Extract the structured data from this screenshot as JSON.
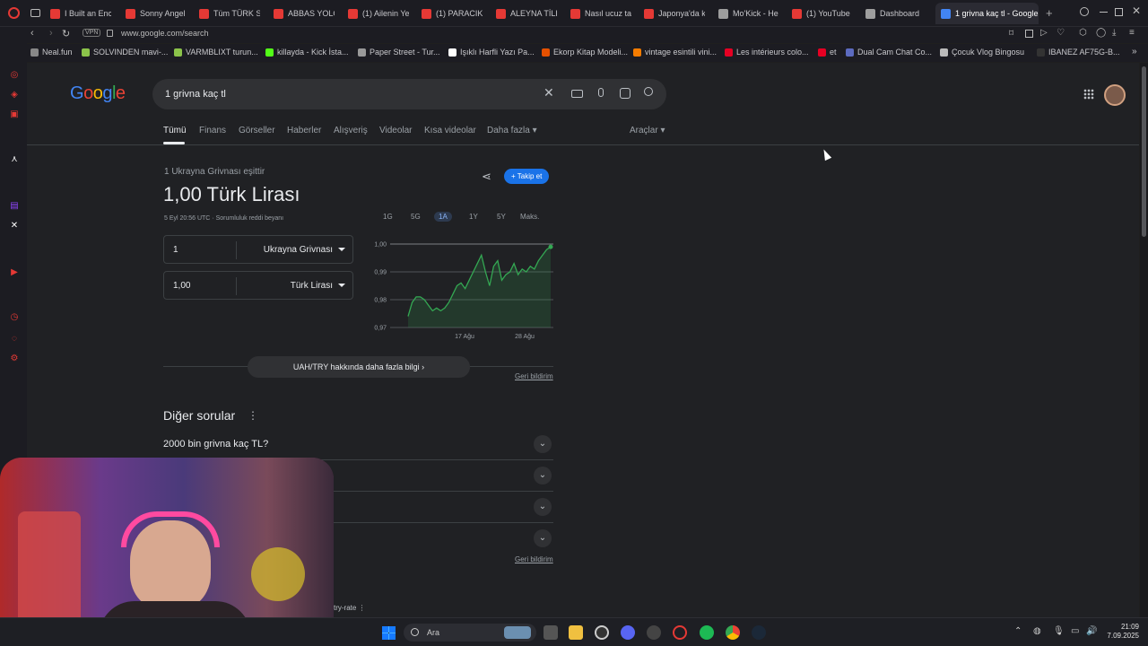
{
  "tabs": [
    {
      "label": "I Built an Enc",
      "color": "#e53935"
    },
    {
      "label": "Sonny Angel",
      "color": "#e53935"
    },
    {
      "label": "Tüm TÜRK Se",
      "color": "#e53935"
    },
    {
      "label": "ABBAS YOLO",
      "color": "#e53935"
    },
    {
      "label": "(1) Ailenin Ye",
      "color": "#e53935"
    },
    {
      "label": "(1) PARACIKL",
      "color": "#e53935"
    },
    {
      "label": "ALEYNA TİLK",
      "color": "#e53935"
    },
    {
      "label": "Nasıl ucuz ta",
      "color": "#e53935"
    },
    {
      "label": "Japonya'da k",
      "color": "#e53935"
    },
    {
      "label": "Mo'Kick - He",
      "color": "#9e9e9e"
    },
    {
      "label": "(1) YouTube",
      "color": "#e53935"
    },
    {
      "label": "Dashboard",
      "color": "#9e9e9e"
    },
    {
      "label": "1 grivna kaç tl - Google",
      "color": "#4285f4"
    }
  ],
  "address": {
    "vpn": "VPN",
    "url": "www.google.com/search"
  },
  "bookmarks": [
    {
      "label": "Neal.fun",
      "color": "#888"
    },
    {
      "label": "SOLVINDEN mavi-...",
      "color": "#8bc34a"
    },
    {
      "label": "VARMBLIXT turun...",
      "color": "#8bc34a"
    },
    {
      "label": "killayda - Kick İsta...",
      "color": "#53fc18"
    },
    {
      "label": "Paper Street - Tur...",
      "color": "#999"
    },
    {
      "label": "Işıklı Harfli Yazı Pa...",
      "color": "#fff"
    },
    {
      "label": "Ekorp Kitap Modeli...",
      "color": "#e65100"
    },
    {
      "label": "vintage esintili vini...",
      "color": "#f57c00"
    },
    {
      "label": "Les intérieurs colo...",
      "color": "#e60023"
    },
    {
      "label": "et",
      "color": "#e60023"
    },
    {
      "label": "Dual Cam Chat Co...",
      "color": "#5c6bc0"
    },
    {
      "label": "Çocuk Vlog Bingosu",
      "color": "#bbb"
    },
    {
      "label": "IBANEZ AF75G-B...",
      "color": "#333"
    }
  ],
  "search": {
    "logo": "Google",
    "query": "1 grivna kaç tl"
  },
  "nav": {
    "tabs": [
      "Tümü",
      "Finans",
      "Görseller",
      "Haberler",
      "Alışveriş",
      "Videolar",
      "Kısa videolar",
      "Daha fazla"
    ],
    "tools": "Araçlar"
  },
  "converter": {
    "subtitle": "1 Ukrayna Grivnası eşittir",
    "result": "1,00 Türk Lirası",
    "timestamp": "5 Eyl 20:56 UTC",
    "disclaimer": "Sorumluluk reddi beyanı",
    "follow": "Takip et",
    "from_value": "1",
    "from_currency": "Ukrayna Grivnası",
    "to_value": "1,00",
    "to_currency": "Türk Lirası",
    "more_info": "UAH/TRY hakkında daha fazla bilgi",
    "feedback": "Geri bildirim"
  },
  "ranges": [
    "1G",
    "5G",
    "1A",
    "1Y",
    "5Y",
    "Maks."
  ],
  "selected_range": "1A",
  "chart_data": {
    "type": "line",
    "y_ticks": [
      "1,00",
      "0,99",
      "0,98",
      "0,97"
    ],
    "ylim": [
      0.97,
      1.0
    ],
    "x_ticks": [
      "17 Ağu",
      "28 Ağu"
    ],
    "series": [
      {
        "values": [
          0.974,
          0.979,
          0.981,
          0.981,
          0.98,
          0.978,
          0.976,
          0.977,
          0.976,
          0.977,
          0.979,
          0.982,
          0.985,
          0.986,
          0.984,
          0.987,
          0.99,
          0.993,
          0.996,
          0.99,
          0.985,
          0.992,
          0.994,
          0.987,
          0.989,
          0.99,
          0.993,
          0.989,
          0.991,
          0.99,
          0.992,
          0.991,
          0.994,
          0.996,
          0.998,
          0.999
        ]
      }
    ],
    "color": "#34a853"
  },
  "other_questions": {
    "title": "Diğer sorular",
    "items": [
      "2000 bin grivna kaç TL?"
    ],
    "feedback": "Geri bildirim",
    "footer": "try-rate"
  },
  "taskbar": {
    "search": "Ara",
    "time": "21:09",
    "date": "7.09.2025"
  }
}
